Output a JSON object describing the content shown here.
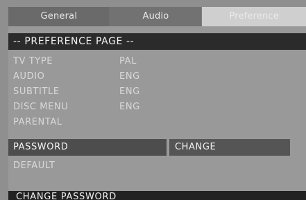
{
  "tabs": [
    {
      "label": "General"
    },
    {
      "label": "Audio"
    },
    {
      "label": "Preference"
    }
  ],
  "page_header": "-- PREFERENCE PAGE --",
  "menu_items": [
    {
      "label": "TV TYPE",
      "value": "PAL"
    },
    {
      "label": "AUDIO",
      "value": "ENG"
    },
    {
      "label": "SUBTITLE",
      "value": "ENG"
    },
    {
      "label": "DISC MENU",
      "value": "ENG"
    },
    {
      "label": "PARENTAL",
      "value": ""
    },
    {
      "label": "PASSWORD",
      "value": ""
    },
    {
      "label": "DEFAULT",
      "value": ""
    }
  ],
  "selected_item": "PASSWORD",
  "submenu_option": "CHANGE",
  "status_text": "CHANGE PASSWORD"
}
